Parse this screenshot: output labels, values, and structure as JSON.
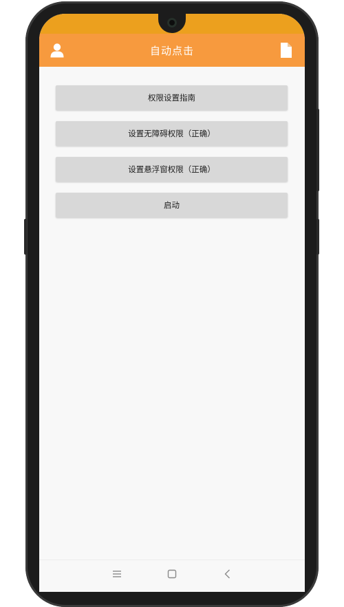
{
  "toolbar": {
    "title": "自动点击",
    "left_icon": "user-icon",
    "right_icon": "document-icon",
    "background": "#f79a3e"
  },
  "statusbar": {
    "background": "#eca01e"
  },
  "buttons": [
    {
      "label": "权限设置指南"
    },
    {
      "label": "设置无障碍权限（正确）"
    },
    {
      "label": "设置悬浮窗权限（正确）"
    },
    {
      "label": "启动"
    }
  ],
  "navbar": {
    "icons": [
      "menu-icon",
      "home-icon",
      "back-icon"
    ]
  }
}
